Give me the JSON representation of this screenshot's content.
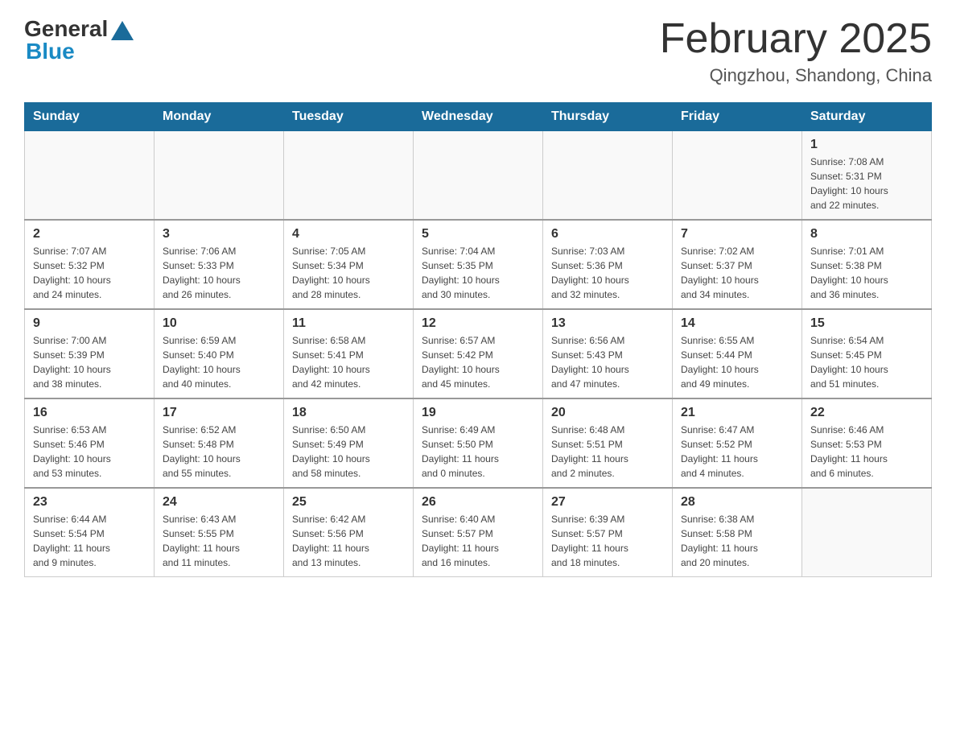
{
  "header": {
    "logo_general": "General",
    "logo_blue": "Blue",
    "title": "February 2025",
    "subtitle": "Qingzhou, Shandong, China"
  },
  "weekdays": [
    "Sunday",
    "Monday",
    "Tuesday",
    "Wednesday",
    "Thursday",
    "Friday",
    "Saturday"
  ],
  "weeks": [
    [
      {
        "day": "",
        "info": ""
      },
      {
        "day": "",
        "info": ""
      },
      {
        "day": "",
        "info": ""
      },
      {
        "day": "",
        "info": ""
      },
      {
        "day": "",
        "info": ""
      },
      {
        "day": "",
        "info": ""
      },
      {
        "day": "1",
        "info": "Sunrise: 7:08 AM\nSunset: 5:31 PM\nDaylight: 10 hours\nand 22 minutes."
      }
    ],
    [
      {
        "day": "2",
        "info": "Sunrise: 7:07 AM\nSunset: 5:32 PM\nDaylight: 10 hours\nand 24 minutes."
      },
      {
        "day": "3",
        "info": "Sunrise: 7:06 AM\nSunset: 5:33 PM\nDaylight: 10 hours\nand 26 minutes."
      },
      {
        "day": "4",
        "info": "Sunrise: 7:05 AM\nSunset: 5:34 PM\nDaylight: 10 hours\nand 28 minutes."
      },
      {
        "day": "5",
        "info": "Sunrise: 7:04 AM\nSunset: 5:35 PM\nDaylight: 10 hours\nand 30 minutes."
      },
      {
        "day": "6",
        "info": "Sunrise: 7:03 AM\nSunset: 5:36 PM\nDaylight: 10 hours\nand 32 minutes."
      },
      {
        "day": "7",
        "info": "Sunrise: 7:02 AM\nSunset: 5:37 PM\nDaylight: 10 hours\nand 34 minutes."
      },
      {
        "day": "8",
        "info": "Sunrise: 7:01 AM\nSunset: 5:38 PM\nDaylight: 10 hours\nand 36 minutes."
      }
    ],
    [
      {
        "day": "9",
        "info": "Sunrise: 7:00 AM\nSunset: 5:39 PM\nDaylight: 10 hours\nand 38 minutes."
      },
      {
        "day": "10",
        "info": "Sunrise: 6:59 AM\nSunset: 5:40 PM\nDaylight: 10 hours\nand 40 minutes."
      },
      {
        "day": "11",
        "info": "Sunrise: 6:58 AM\nSunset: 5:41 PM\nDaylight: 10 hours\nand 42 minutes."
      },
      {
        "day": "12",
        "info": "Sunrise: 6:57 AM\nSunset: 5:42 PM\nDaylight: 10 hours\nand 45 minutes."
      },
      {
        "day": "13",
        "info": "Sunrise: 6:56 AM\nSunset: 5:43 PM\nDaylight: 10 hours\nand 47 minutes."
      },
      {
        "day": "14",
        "info": "Sunrise: 6:55 AM\nSunset: 5:44 PM\nDaylight: 10 hours\nand 49 minutes."
      },
      {
        "day": "15",
        "info": "Sunrise: 6:54 AM\nSunset: 5:45 PM\nDaylight: 10 hours\nand 51 minutes."
      }
    ],
    [
      {
        "day": "16",
        "info": "Sunrise: 6:53 AM\nSunset: 5:46 PM\nDaylight: 10 hours\nand 53 minutes."
      },
      {
        "day": "17",
        "info": "Sunrise: 6:52 AM\nSunset: 5:48 PM\nDaylight: 10 hours\nand 55 minutes."
      },
      {
        "day": "18",
        "info": "Sunrise: 6:50 AM\nSunset: 5:49 PM\nDaylight: 10 hours\nand 58 minutes."
      },
      {
        "day": "19",
        "info": "Sunrise: 6:49 AM\nSunset: 5:50 PM\nDaylight: 11 hours\nand 0 minutes."
      },
      {
        "day": "20",
        "info": "Sunrise: 6:48 AM\nSunset: 5:51 PM\nDaylight: 11 hours\nand 2 minutes."
      },
      {
        "day": "21",
        "info": "Sunrise: 6:47 AM\nSunset: 5:52 PM\nDaylight: 11 hours\nand 4 minutes."
      },
      {
        "day": "22",
        "info": "Sunrise: 6:46 AM\nSunset: 5:53 PM\nDaylight: 11 hours\nand 6 minutes."
      }
    ],
    [
      {
        "day": "23",
        "info": "Sunrise: 6:44 AM\nSunset: 5:54 PM\nDaylight: 11 hours\nand 9 minutes."
      },
      {
        "day": "24",
        "info": "Sunrise: 6:43 AM\nSunset: 5:55 PM\nDaylight: 11 hours\nand 11 minutes."
      },
      {
        "day": "25",
        "info": "Sunrise: 6:42 AM\nSunset: 5:56 PM\nDaylight: 11 hours\nand 13 minutes."
      },
      {
        "day": "26",
        "info": "Sunrise: 6:40 AM\nSunset: 5:57 PM\nDaylight: 11 hours\nand 16 minutes."
      },
      {
        "day": "27",
        "info": "Sunrise: 6:39 AM\nSunset: 5:57 PM\nDaylight: 11 hours\nand 18 minutes."
      },
      {
        "day": "28",
        "info": "Sunrise: 6:38 AM\nSunset: 5:58 PM\nDaylight: 11 hours\nand 20 minutes."
      },
      {
        "day": "",
        "info": ""
      }
    ]
  ]
}
